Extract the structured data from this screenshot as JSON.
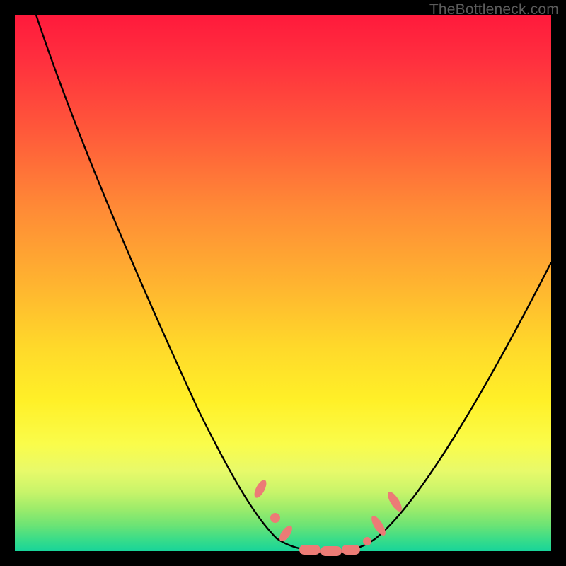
{
  "watermark": "TheBottleneck.com",
  "colors": {
    "frame": "#000000",
    "curve": "#000000",
    "marker_fill": "#ec7b76",
    "gradient_top": "#ff1a3c",
    "gradient_bottom": "#18d49a"
  },
  "chart_data": {
    "type": "line",
    "title": "",
    "xlabel": "",
    "ylabel": "",
    "xlim": [
      0,
      100
    ],
    "ylim": [
      0,
      100
    ],
    "series": [
      {
        "name": "bottleneck-curve",
        "x": [
          4,
          10,
          18,
          26,
          34,
          40,
          45,
          48,
          50,
          53,
          56,
          59,
          62,
          65,
          70,
          76,
          84,
          92,
          100
        ],
        "values": [
          100,
          86,
          71,
          56,
          41,
          28,
          16,
          9,
          4,
          1,
          0,
          0,
          1,
          3,
          9,
          18,
          31,
          44,
          56
        ]
      }
    ],
    "markers": [
      {
        "x": 46,
        "y": 12,
        "shape": "pill-diag",
        "size": 4
      },
      {
        "x": 49,
        "y": 6,
        "shape": "dot",
        "size": 3
      },
      {
        "x": 51,
        "y": 3,
        "shape": "pill-diag",
        "size": 4
      },
      {
        "x": 55,
        "y": 0,
        "shape": "pill-h",
        "size": 5
      },
      {
        "x": 58,
        "y": 0,
        "shape": "pill-h",
        "size": 5
      },
      {
        "x": 61,
        "y": 0,
        "shape": "pill-h",
        "size": 5
      },
      {
        "x": 64,
        "y": 2,
        "shape": "dot",
        "size": 3
      },
      {
        "x": 66,
        "y": 5,
        "shape": "pill-diag-r",
        "size": 5
      },
      {
        "x": 69,
        "y": 9,
        "shape": "pill-diag-r",
        "size": 5
      }
    ],
    "annotations": []
  }
}
